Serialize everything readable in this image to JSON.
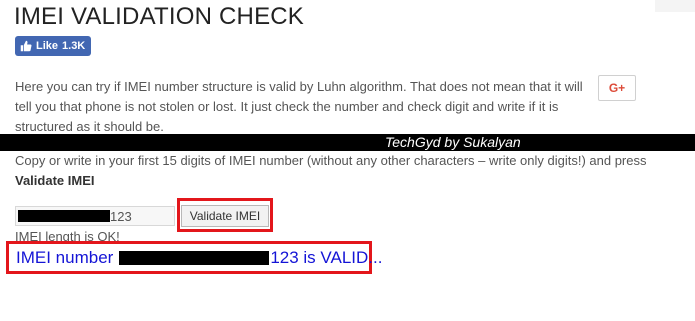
{
  "page": {
    "title": "IMEI VALIDATION CHECK"
  },
  "social": {
    "fb_like_label": "Like",
    "fb_like_count": "1.3K",
    "gplus_label": "G+"
  },
  "intro": {
    "text": "Here you can try if IMEI number structure is valid by Luhn algorithm. That does not mean that it will tell you that phone is not stolen or lost. It just check the number and check digit and write if it is structured as it should be."
  },
  "banner": {
    "text": "TechGyd by Sukalyan"
  },
  "instructions": {
    "text": "Copy or write in your first 15 digits of IMEI number (without any other characters – write only digits!) and press ",
    "bold": "Validate IMEI"
  },
  "form": {
    "imei_visible_suffix": "123",
    "validate_button_label": "Validate IMEI"
  },
  "status": {
    "length_message": "IMEI length is OK!"
  },
  "result": {
    "prefix": "IMEI number",
    "suffix": "123 is VALID..."
  },
  "colors": {
    "facebook": "#4267b2",
    "highlight_red": "#e3161b",
    "result_blue": "#1414d6",
    "banner_black": "#000000"
  }
}
